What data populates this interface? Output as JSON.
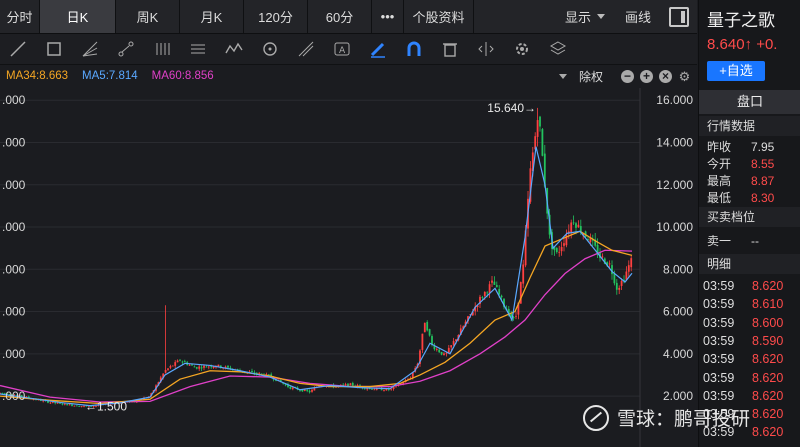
{
  "tabs": [
    "分时",
    "日K",
    "周K",
    "月K",
    "120分",
    "60分",
    "•••",
    "个股资料"
  ],
  "active_tab": 1,
  "top_right": {
    "display_label": "显示",
    "draw_label": "画线"
  },
  "chart_data": {
    "type": "candlestick",
    "title": "",
    "indicators": [
      {
        "name": "MA34",
        "value": "8.663",
        "color": "#f5a623"
      },
      {
        "name": "MA5",
        "value": "7.814",
        "color": "#5aa8ff"
      },
      {
        "name": "MA60",
        "value": "8.856",
        "color": "#e040c8"
      }
    ],
    "adjust_label": "除权",
    "y_ticks_right": [
      "16.000",
      "14.000",
      "12.000",
      "10.000",
      "8.000",
      "6.000",
      "4.000",
      "2.000"
    ],
    "y_ticks_left": [
      ".000",
      ".000",
      ".000",
      ".000",
      ".000",
      ".000",
      ".000",
      ".000"
    ],
    "ylim": [
      1.2,
      16.2
    ],
    "max_label": "15.640→",
    "min_label": "←1.500",
    "up_color": "#ff4040",
    "down_color": "#22c35e",
    "price_path": [
      [
        0,
        2.15
      ],
      [
        25,
        1.95
      ],
      [
        50,
        1.7
      ],
      [
        75,
        1.55
      ],
      [
        90,
        1.5
      ],
      [
        110,
        1.65
      ],
      [
        135,
        1.75
      ],
      [
        150,
        2.0
      ],
      [
        165,
        3.2
      ],
      [
        180,
        3.7
      ],
      [
        195,
        3.35
      ],
      [
        215,
        3.45
      ],
      [
        240,
        3.2
      ],
      [
        270,
        2.95
      ],
      [
        290,
        2.4
      ],
      [
        310,
        2.2
      ],
      [
        320,
        2.55
      ],
      [
        335,
        2.45
      ],
      [
        350,
        2.55
      ],
      [
        370,
        2.35
      ],
      [
        390,
        2.3
      ],
      [
        410,
        2.85
      ],
      [
        418,
        3.6
      ],
      [
        425,
        5.6
      ],
      [
        432,
        4.4
      ],
      [
        445,
        3.9
      ],
      [
        462,
        5.2
      ],
      [
        480,
        6.6
      ],
      [
        493,
        7.4
      ],
      [
        505,
        6.2
      ],
      [
        515,
        5.5
      ],
      [
        523,
        8.0
      ],
      [
        530,
        12.5
      ],
      [
        536,
        14.6
      ],
      [
        538,
        15.6
      ],
      [
        543,
        13.0
      ],
      [
        550,
        9.3
      ],
      [
        557,
        8.7
      ],
      [
        565,
        9.5
      ],
      [
        573,
        10.4
      ],
      [
        580,
        9.9
      ],
      [
        590,
        9.4
      ],
      [
        600,
        8.6
      ],
      [
        610,
        8.2
      ],
      [
        617,
        7.1
      ],
      [
        623,
        7.5
      ],
      [
        632,
        8.5
      ]
    ],
    "ma34_path": [
      [
        0,
        2.0
      ],
      [
        50,
        1.8
      ],
      [
        100,
        1.65
      ],
      [
        150,
        1.85
      ],
      [
        180,
        2.8
      ],
      [
        210,
        3.2
      ],
      [
        240,
        3.15
      ],
      [
        270,
        2.95
      ],
      [
        300,
        2.6
      ],
      [
        330,
        2.45
      ],
      [
        370,
        2.45
      ],
      [
        400,
        2.6
      ],
      [
        420,
        3.0
      ],
      [
        445,
        3.6
      ],
      [
        470,
        4.5
      ],
      [
        495,
        5.6
      ],
      [
        515,
        6.0
      ],
      [
        530,
        7.6
      ],
      [
        545,
        9.1
      ],
      [
        560,
        9.4
      ],
      [
        580,
        9.8
      ],
      [
        597,
        9.3
      ],
      [
        612,
        8.9
      ],
      [
        632,
        8.66
      ]
    ],
    "ma60_path": [
      [
        0,
        2.5
      ],
      [
        50,
        1.95
      ],
      [
        100,
        1.72
      ],
      [
        150,
        1.75
      ],
      [
        190,
        2.45
      ],
      [
        230,
        2.95
      ],
      [
        270,
        2.9
      ],
      [
        310,
        2.6
      ],
      [
        350,
        2.45
      ],
      [
        390,
        2.45
      ],
      [
        420,
        2.7
      ],
      [
        450,
        3.2
      ],
      [
        480,
        4.0
      ],
      [
        505,
        4.8
      ],
      [
        525,
        5.6
      ],
      [
        545,
        6.8
      ],
      [
        565,
        7.8
      ],
      [
        585,
        8.5
      ],
      [
        605,
        8.9
      ],
      [
        632,
        8.86
      ]
    ],
    "ma5_path": [
      [
        0,
        2.1
      ],
      [
        30,
        1.9
      ],
      [
        60,
        1.7
      ],
      [
        90,
        1.55
      ],
      [
        120,
        1.68
      ],
      [
        150,
        1.95
      ],
      [
        165,
        3.0
      ],
      [
        185,
        3.55
      ],
      [
        210,
        3.45
      ],
      [
        240,
        3.2
      ],
      [
        270,
        2.9
      ],
      [
        300,
        2.3
      ],
      [
        330,
        2.5
      ],
      [
        360,
        2.4
      ],
      [
        390,
        2.35
      ],
      [
        415,
        3.2
      ],
      [
        430,
        4.5
      ],
      [
        450,
        4.0
      ],
      [
        475,
        6.2
      ],
      [
        495,
        7.1
      ],
      [
        512,
        5.6
      ],
      [
        525,
        9.5
      ],
      [
        536,
        13.8
      ],
      [
        545,
        12.0
      ],
      [
        553,
        9.0
      ],
      [
        567,
        9.7
      ],
      [
        580,
        9.8
      ],
      [
        597,
        8.8
      ],
      [
        612,
        7.9
      ],
      [
        625,
        7.4
      ],
      [
        632,
        7.81
      ]
    ]
  },
  "sidebar": {
    "name": "量子之歌",
    "price": "8.640↑ +0.",
    "add_button": "+自选",
    "panel_header": "盘口",
    "quote_section": "行情数据",
    "quotes": [
      {
        "label": "昨收",
        "value": "7.95",
        "color": "#dddddd"
      },
      {
        "label": "今开",
        "value": "8.55",
        "color": "#ff4b4b"
      },
      {
        "label": "最高",
        "value": "8.87",
        "color": "#ff4b4b"
      },
      {
        "label": "最低",
        "value": "8.30",
        "color": "#ff4b4b"
      }
    ],
    "bidask_section": "买卖档位",
    "bid_label": "卖一",
    "bid_value": "--",
    "detail_section": "明细",
    "ticks": [
      {
        "time": "03:59",
        "price": "8.620"
      },
      {
        "time": "03:59",
        "price": "8.610"
      },
      {
        "time": "03:59",
        "price": "8.600"
      },
      {
        "time": "03:59",
        "price": "8.590"
      },
      {
        "time": "03:59",
        "price": "8.620"
      },
      {
        "time": "03:59",
        "price": "8.620"
      },
      {
        "time": "03:59",
        "price": "8.620"
      },
      {
        "time": "03:59",
        "price": "8.620"
      },
      {
        "time": "03:59",
        "price": "8.620"
      }
    ]
  },
  "watermark": "雪球：鹏哥投研"
}
